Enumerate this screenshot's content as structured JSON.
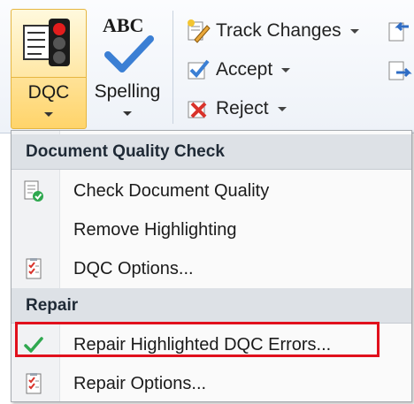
{
  "ribbon": {
    "dqc_label": "DQC",
    "spelling_label": "Spelling",
    "spelling_abc": "ABC",
    "track_changes_label": "Track Changes",
    "accept_label": "Accept",
    "reject_label": "Reject"
  },
  "menu": {
    "section1_title": "Document Quality Check",
    "items1": [
      {
        "label": "Check Document Quality",
        "icon": "document-check-icon"
      },
      {
        "label": "Remove Highlighting",
        "icon": ""
      },
      {
        "label": "DQC Options...",
        "icon": "checklist-icon"
      }
    ],
    "section2_title": "Repair",
    "items2": [
      {
        "label": "Repair Highlighted DQC Errors...",
        "icon": "green-check-icon"
      },
      {
        "label": "Repair Options...",
        "icon": "checklist-icon"
      }
    ]
  },
  "colors": {
    "highlight_border": "#e1101c",
    "accent_yellow": "#ffe39a"
  }
}
